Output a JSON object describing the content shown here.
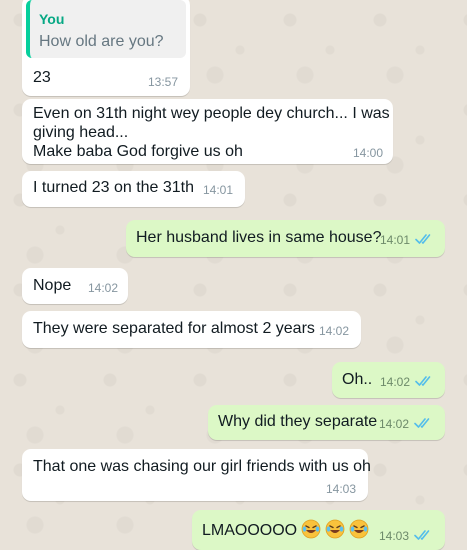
{
  "colors": {
    "incoming_bubble": "#ffffff",
    "outgoing_bubble": "#dcf8c6",
    "read_ticks": "#53bdeb",
    "quote_bar": "#06cf9c",
    "wallpaper": "#e8e2d9"
  },
  "messages": [
    {
      "direction": "in",
      "quoted_author": "You",
      "quoted_text": "How old are you?",
      "text": "23",
      "time": "13:57"
    },
    {
      "direction": "in",
      "text_line1": "Even on 31th night wey people dey church... I was",
      "text_line2": "giving head...",
      "text_line3": "Make baba God forgive us oh",
      "time": "14:00"
    },
    {
      "direction": "in",
      "text": "I turned 23 on the 31th",
      "time": "14:01"
    },
    {
      "direction": "out",
      "text": "Her husband lives in same house?",
      "time": "14:01",
      "status": "read"
    },
    {
      "direction": "in",
      "text": "Nope",
      "time": "14:02"
    },
    {
      "direction": "in",
      "text": "They were separated for almost 2 years",
      "time": "14:02"
    },
    {
      "direction": "out",
      "text": "Oh..",
      "time": "14:02",
      "status": "read"
    },
    {
      "direction": "out",
      "text": "Why did they separate",
      "time": "14:02",
      "status": "read"
    },
    {
      "direction": "in",
      "text": "That one was chasing our girl friends with us oh",
      "time": "14:03"
    },
    {
      "direction": "out",
      "text": "LMAOOOOO",
      "emoji_name": "rolling-on-floor-laughing-emoji",
      "emoji_count": 3,
      "time": "14:03",
      "status": "read"
    }
  ]
}
